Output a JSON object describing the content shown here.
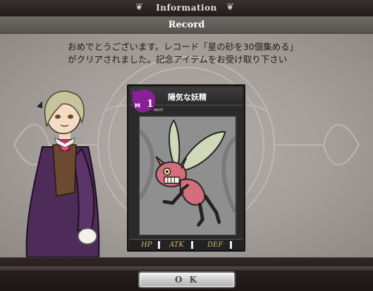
{
  "header": {
    "title": "Information"
  },
  "dialog": {
    "title": "Record",
    "message_line1": "おめでとうございます。レコード「星の砂を30個集める」",
    "message_line2": "がクリアされました。記念アイテムをお受け取り下さい"
  },
  "card": {
    "name": "陽気な妖精",
    "rank": "M",
    "level": "1",
    "next_label": "next",
    "stats": {
      "hp_label": "HP",
      "atk_label": "ATK",
      "def_label": "DEF"
    }
  },
  "actions": {
    "ok_label": "O K"
  },
  "colors": {
    "accent_purple": "#8a1f9a",
    "stat_gold": "#d7b56a",
    "panel_bg": "#a8a39f"
  }
}
